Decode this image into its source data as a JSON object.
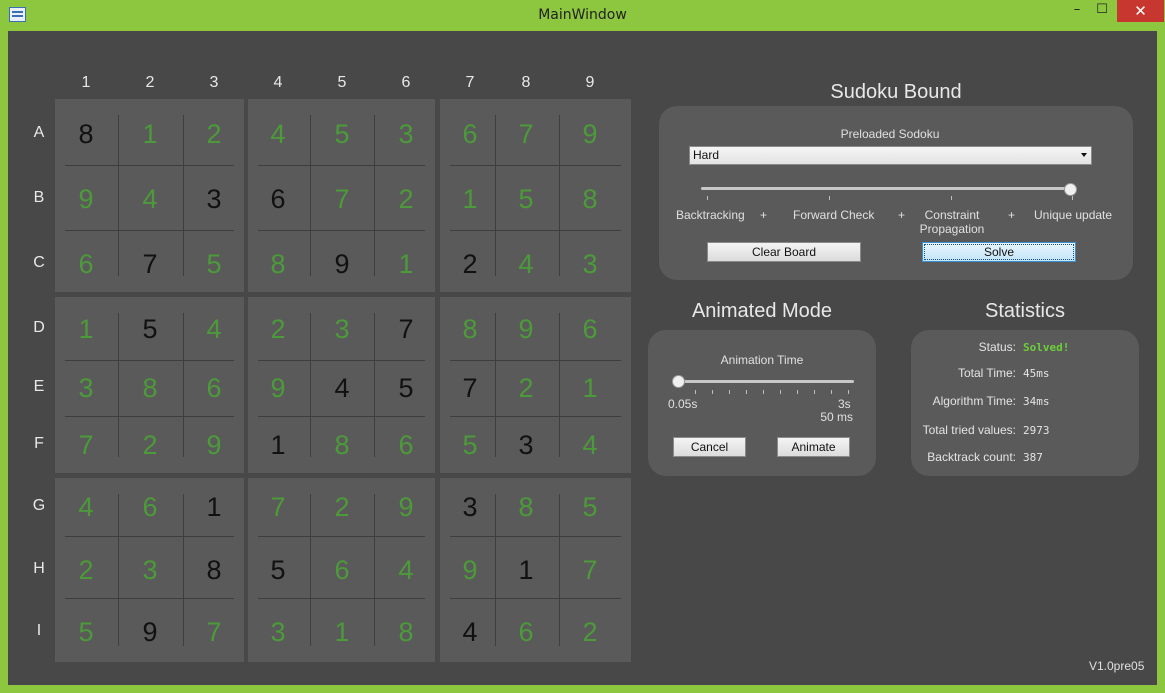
{
  "window": {
    "title": "MainWindow",
    "min": "–",
    "max": "☐",
    "close": "✕"
  },
  "grid": {
    "col_labels": [
      "1",
      "2",
      "3",
      "4",
      "5",
      "6",
      "7",
      "8",
      "9"
    ],
    "row_labels": [
      "A",
      "B",
      "C",
      "D",
      "E",
      "F",
      "G",
      "H",
      "I"
    ],
    "values": [
      [
        "8",
        "1",
        "2",
        "4",
        "5",
        "3",
        "6",
        "7",
        "9"
      ],
      [
        "9",
        "4",
        "3",
        "6",
        "7",
        "2",
        "1",
        "5",
        "8"
      ],
      [
        "6",
        "7",
        "5",
        "8",
        "9",
        "1",
        "2",
        "4",
        "3"
      ],
      [
        "1",
        "5",
        "4",
        "2",
        "3",
        "7",
        "8",
        "9",
        "6"
      ],
      [
        "3",
        "8",
        "6",
        "9",
        "4",
        "5",
        "7",
        "2",
        "1"
      ],
      [
        "7",
        "2",
        "9",
        "1",
        "8",
        "6",
        "5",
        "3",
        "4"
      ],
      [
        "4",
        "6",
        "1",
        "7",
        "2",
        "9",
        "3",
        "8",
        "5"
      ],
      [
        "2",
        "3",
        "8",
        "5",
        "6",
        "4",
        "9",
        "1",
        "7"
      ],
      [
        "5",
        "9",
        "7",
        "3",
        "1",
        "8",
        "4",
        "6",
        "2"
      ]
    ],
    "given": [
      [
        1,
        0,
        0,
        0,
        0,
        0,
        0,
        0,
        0
      ],
      [
        0,
        0,
        1,
        1,
        0,
        0,
        0,
        0,
        0
      ],
      [
        0,
        1,
        0,
        0,
        1,
        0,
        1,
        0,
        0
      ],
      [
        0,
        1,
        0,
        0,
        0,
        1,
        0,
        0,
        0
      ],
      [
        0,
        0,
        0,
        0,
        1,
        1,
        1,
        0,
        0
      ],
      [
        0,
        0,
        0,
        1,
        0,
        0,
        0,
        1,
        0
      ],
      [
        0,
        0,
        1,
        0,
        0,
        0,
        1,
        0,
        0
      ],
      [
        0,
        0,
        1,
        1,
        0,
        0,
        0,
        1,
        0
      ],
      [
        0,
        1,
        0,
        0,
        0,
        0,
        1,
        0,
        0
      ]
    ],
    "colors": {
      "given": "#111111",
      "solved": "#4c9a3a"
    }
  },
  "sudoku_bound": {
    "title": "Sudoku Bound",
    "preloaded_label": "Preloaded Sodoku",
    "preloaded_value": "Hard",
    "slider_value": 1.0,
    "slider_labels": {
      "backtracking": "Backtracking",
      "plus1": "+",
      "forward_check": "Forward Check",
      "plus2": "+",
      "constraint_line1": "Constraint",
      "constraint_line2": "Propagation",
      "plus3": "+",
      "unique_update": "Unique update"
    },
    "clear_button": "Clear Board",
    "solve_button": "Solve"
  },
  "animated_mode": {
    "title": "Animated Mode",
    "time_label": "Animation Time",
    "slider_value": 0.0,
    "min_label": "0.05s",
    "max_label": "3s",
    "current_value": "50 ms",
    "cancel_button": "Cancel",
    "animate_button": "Animate"
  },
  "statistics": {
    "title": "Statistics",
    "rows": [
      {
        "label": "Status:",
        "value": "Solved!"
      },
      {
        "label": "Total Time:",
        "value": "45ms"
      },
      {
        "label": "Algorithm Time:",
        "value": "34ms"
      },
      {
        "label": "Total tried values:",
        "value": "2973"
      },
      {
        "label": "Backtrack count:",
        "value": "387"
      }
    ],
    "status_color": "#6bcf3a"
  },
  "version": "V1.0pre05"
}
